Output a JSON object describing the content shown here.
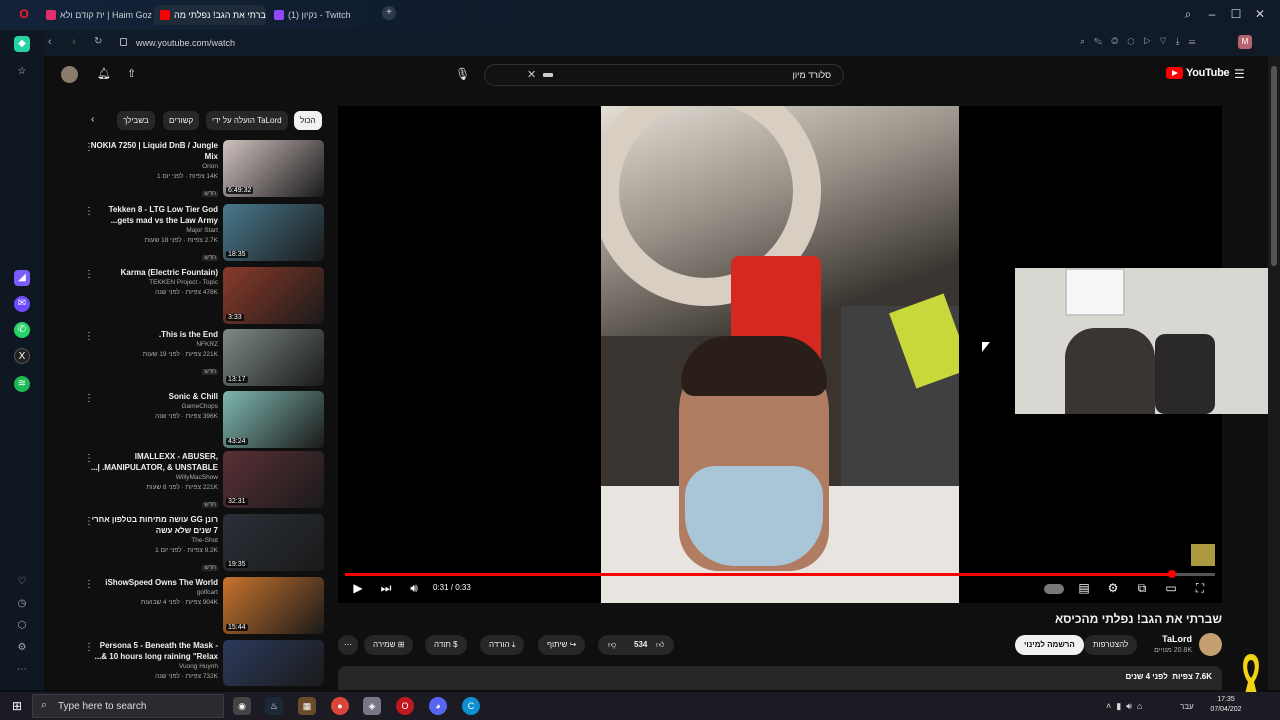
{
  "browser": {
    "tabs": [
      {
        "label": "ית קודם ולא | Haim Gozali"
      },
      {
        "label": "שברתי את הגב! נפלתי מה"
      },
      {
        "label": "(1) נקיון - Twitch"
      }
    ],
    "url": "www.youtube.com/watch"
  },
  "youtube": {
    "logo_text": "YouTube",
    "search_value": "סלורד מיון",
    "chips": [
      "הכול",
      "הועלה על ידי TaLord",
      "קשורים",
      "בשבילך"
    ],
    "videos": [
      {
        "title": "NOKIA 7250 | Liquid DnB / Jungle Mix",
        "channel": "Orion",
        "meta": "14K צפיות · לפני יום 1",
        "badge": "חדש",
        "duration": "6:49:32",
        "thumb": "#cfc2c0"
      },
      {
        "title": "Tekken 8 - LTG Low Tier God gets mad vs the Law Army...",
        "channel": "Major Start",
        "meta": "2.7K צפיות · לפני 18 שעות",
        "badge": "חדש",
        "duration": "18:35",
        "thumb": "#4a7a8e"
      },
      {
        "title": "Karma (Electric Fountain)",
        "channel": "TEKKEN Project - Topic",
        "meta": "478K צפיות · לפני שנה",
        "badge": "",
        "duration": "3:33",
        "thumb": "#8a3a2a"
      },
      {
        "title": "This is the End.",
        "channel": "NFKRZ",
        "meta": "221K צפיות · לפני 19 שעות",
        "badge": "חדש",
        "duration": "13:17",
        "thumb": "#7d8a88"
      },
      {
        "title": "Sonic & Chill",
        "channel": "GameChops",
        "meta": "396K צפיות · לפני שנה",
        "badge": "",
        "duration": "43:24",
        "thumb": "#7fb8b0"
      },
      {
        "title": "IMALLEXX - ABUSER, MANIPULATOR, & UNSTABLE. |...",
        "channel": "WillyMacShow",
        "meta": "221K צפיות · לפני 8 שעות",
        "badge": "חדש",
        "duration": "32:31",
        "thumb": "#5a3036"
      },
      {
        "title": "רונן GG עושה מתיחות בטלפון אחרי 7 שנים שלא עשה",
        "channel": "The-Shot",
        "meta": "9.2K צפיות · לפני יום 1",
        "badge": "חדש",
        "duration": "19:35",
        "thumb": "#2a3038"
      },
      {
        "title": "iShowSpeed Owns The World",
        "channel": "golfcart",
        "meta": "904K צפיות · לפני 4 שבועות",
        "badge": "",
        "duration": "15:44",
        "thumb": "#c8732d"
      },
      {
        "title": "Persona 5 - Beneath the Mask - 10 hours long raining \"Relax &...",
        "channel": "Vuong Huynh",
        "meta": "732K צפיות · לפני שנה",
        "badge": "",
        "duration": "",
        "thumb": "#2c3a5c"
      }
    ],
    "player": {
      "time": "0:31 / 0:33",
      "progress": 0.95
    },
    "video_title": "שברתי את הגב! נפלתי מהכיסא",
    "channel_name": "TaLord",
    "subscribers": "20.8K מנויים",
    "join_label": "להצטרפות",
    "subscribed_label": "הרשמה למינוי",
    "likes": "534",
    "share_label": "שיתוף",
    "download_label": "הורדה",
    "thanks_label": "תודה",
    "save_label": "שמירה",
    "views_line": "7.6K צפיות  לפני 4 שנים"
  },
  "taskbar": {
    "search_placeholder": "Type here to search",
    "clock": "17:35",
    "date": "07/04/202",
    "lang": "עבר"
  },
  "colors": {
    "youtube_red": "#ff0000",
    "bg": "#0f0f0f"
  }
}
